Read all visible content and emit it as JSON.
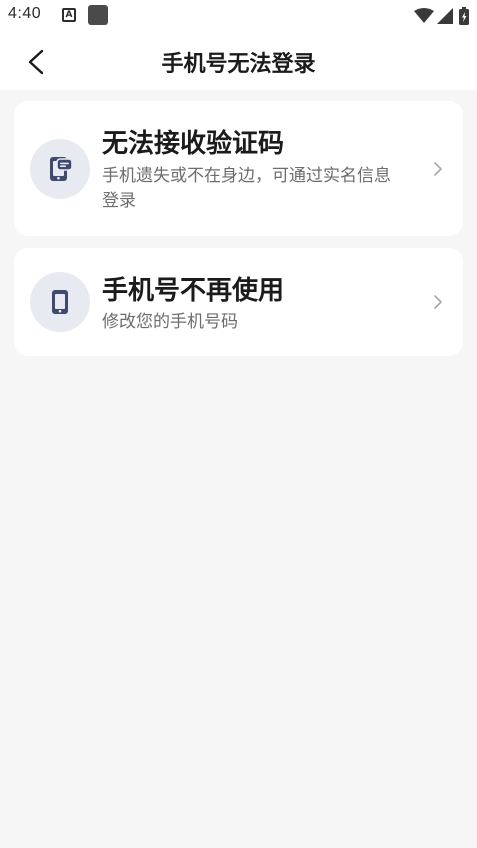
{
  "status_bar": {
    "time": "4:40",
    "notification_icons": [
      "a-badge-icon",
      "square-app-icon"
    ],
    "right_icons": [
      "wifi-icon",
      "signal-icon",
      "battery-charging-icon"
    ]
  },
  "header": {
    "back_icon": "chevron-left-icon",
    "title": "手机号无法登录"
  },
  "options": [
    {
      "title": "无法接收验证码",
      "description": "手机遗失或不在身边，可通过实名信息登录",
      "icon": "phone-message-icon"
    },
    {
      "title": "手机号不再使用",
      "description": "修改您的手机号码",
      "icon": "phone-icon"
    }
  ],
  "colors": {
    "background": "#f6f6f7",
    "card": "#ffffff",
    "icon_circle": "#e7eaf1",
    "icon_fill": "#3f4a6e",
    "chevron": "#a8a8a8"
  }
}
